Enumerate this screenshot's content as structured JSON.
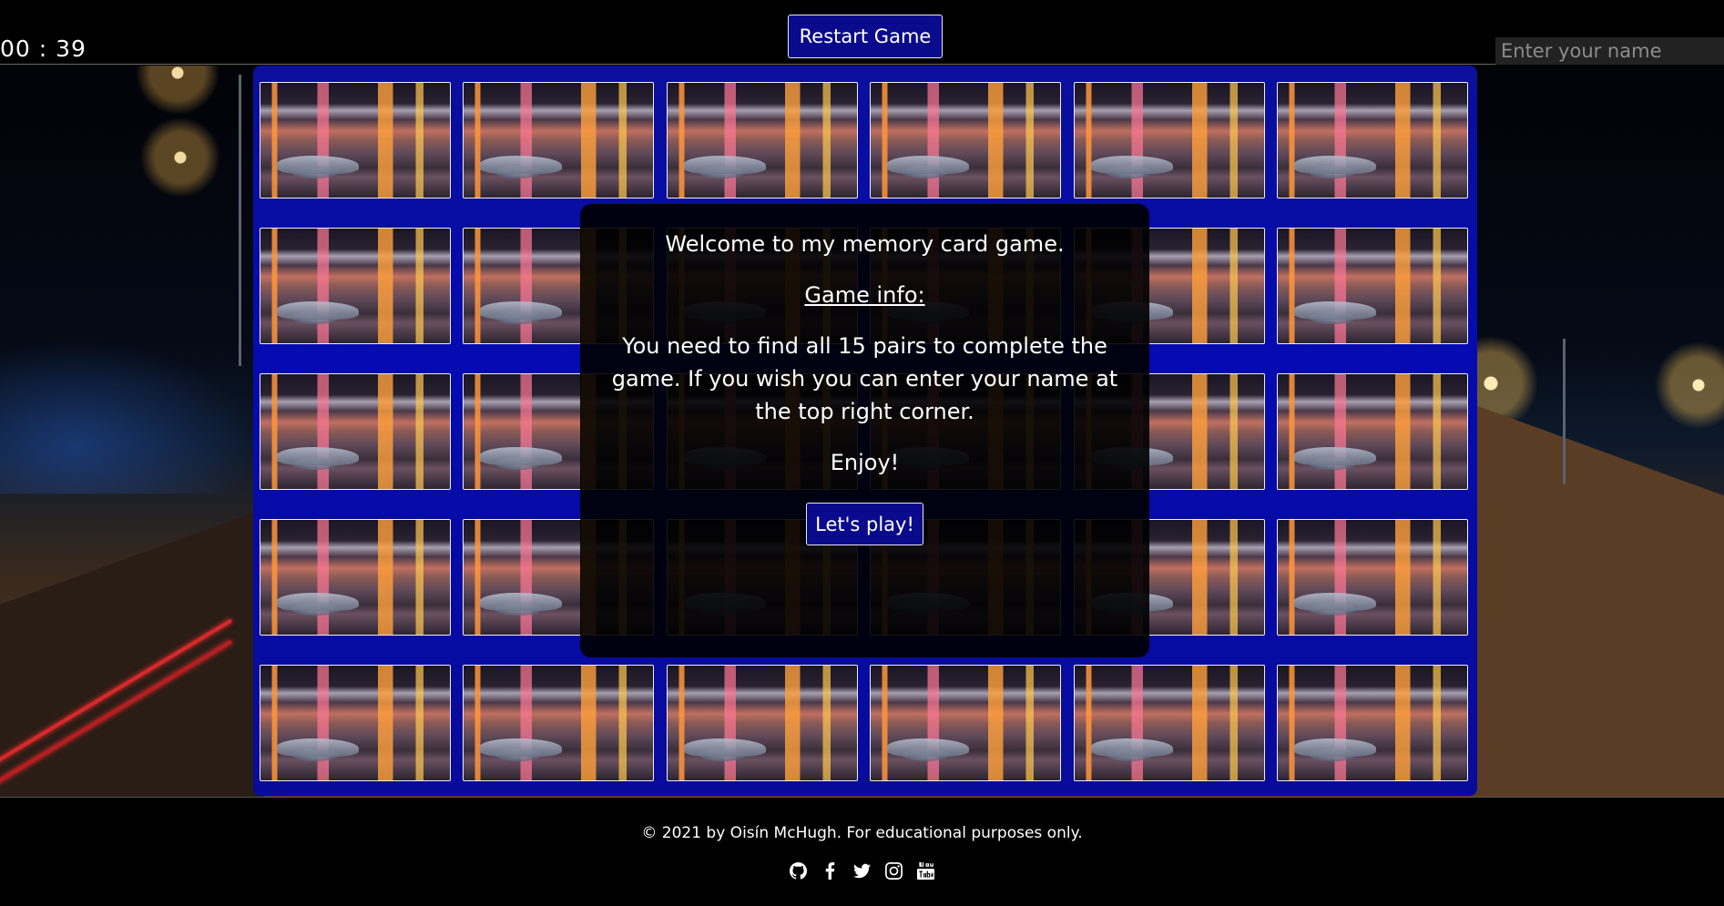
{
  "header": {
    "timer": "00 : 39",
    "restart_label": "Restart Game",
    "name_placeholder": "Enter your name"
  },
  "board": {
    "rows": 5,
    "columns": 6,
    "card_icon": "car-photo-card-back"
  },
  "modal": {
    "welcome": "Welcome to my memory card game.",
    "info_heading": "Game info:",
    "info_text": "You need to find all 15 pairs to complete the game. If you wish you can enter your name at the top right corner.",
    "enjoy": "Enjoy!",
    "play_label": "Let's play!"
  },
  "footer": {
    "copyright": "© 2021 by Oisín McHugh. For educational purposes only.",
    "socials": [
      "github-icon",
      "facebook-icon",
      "twitter-icon",
      "instagram-icon",
      "youtube-icon"
    ]
  },
  "colors": {
    "button_blue": "#0a0a8c",
    "board_blue": "#0508b0",
    "background": "#000000"
  }
}
